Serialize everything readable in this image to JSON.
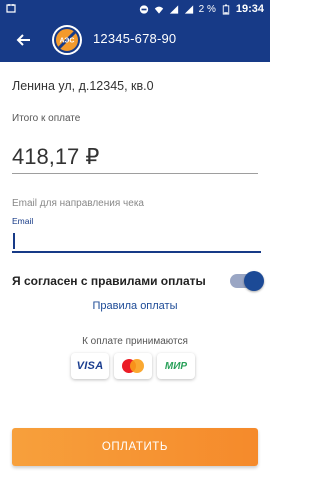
{
  "status_bar": {
    "battery_percent": "2 %",
    "time": "19:34",
    "icons": [
      "notification-icon",
      "vpn-key-icon",
      "wifi-icon",
      "signal-icon",
      "signal-icon",
      "battery-icon"
    ]
  },
  "app_bar": {
    "account_number": "12345-678-90",
    "logo_label": "АЭС",
    "back_icon": "arrow-left-icon"
  },
  "address": "Ленина ул, д.12345, кв.0",
  "total": {
    "label": "Итого к оплате",
    "amount": "418,17 ₽"
  },
  "email": {
    "hint": "Email для направления чека",
    "label": "Email",
    "value": ""
  },
  "agreement": {
    "text": "Я согласен с правилами оплаты",
    "enabled": true
  },
  "rules_link": "Правила оплаты",
  "payment_methods": {
    "title": "К оплате принимаются",
    "visa": "VISA",
    "mir": "МИР"
  },
  "pay_button": "ОПЛАТИТЬ",
  "colors": {
    "primary": "#173a87",
    "accent": "#f7a03c"
  }
}
